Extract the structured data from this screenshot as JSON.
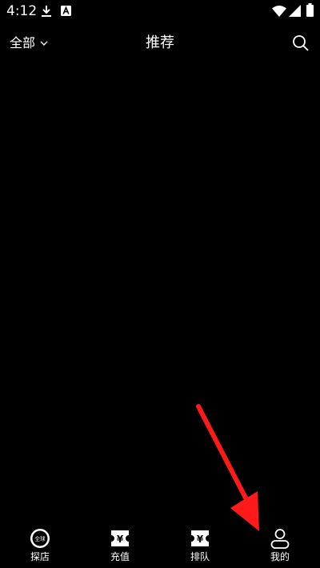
{
  "status_bar": {
    "time": "4:12"
  },
  "header": {
    "city_selector_label": "全部",
    "title": "推荐"
  },
  "bottom_nav": {
    "items": [
      {
        "label": "探店",
        "icon": "explore-store-icon",
        "badge": "全球"
      },
      {
        "label": "充值",
        "icon": "recharge-ticket-icon",
        "badge": "¥"
      },
      {
        "label": "排队",
        "icon": "queue-ticket-icon",
        "badge": "¥"
      },
      {
        "label": "我的",
        "icon": "profile-icon"
      }
    ]
  },
  "colors": {
    "background": "#000000",
    "foreground": "#ffffff",
    "annotation_arrow": "#ff1a1a"
  }
}
